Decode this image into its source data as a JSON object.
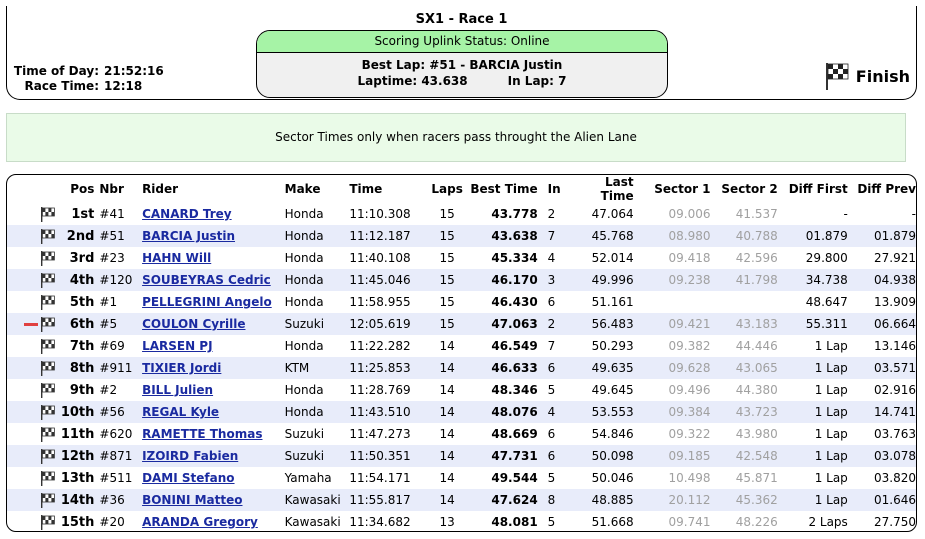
{
  "header": {
    "race_title": "SX1 - Race 1",
    "status_text": "Scoring Uplink Status: Online",
    "best_lap": "Best Lap: #51 - BARCIA Justin",
    "laptime": "Laptime: 43.638",
    "in_lap": "In Lap: 7",
    "time_of_day_label": "Time of Day:",
    "time_of_day": "21:52:16",
    "race_time_label": "Race Time:",
    "race_time": "12:18",
    "finish_label": "Finish"
  },
  "message": "Sector Times only when racers pass throught the Alien Lane",
  "table": {
    "headers": [
      "Pos",
      "Nbr",
      "Rider",
      "Make",
      "Time",
      "Laps",
      "Best Time",
      "In",
      "Last Time",
      "Sector 1",
      "Sector 2",
      "Diff First",
      "Diff Prev"
    ],
    "rows": [
      {
        "pos": "1st",
        "nbr": "#41",
        "rider": "CANARD Trey",
        "make": "Honda",
        "time": "11:10.308",
        "laps": "15",
        "best": "43.778",
        "in": "2",
        "last": "47.064",
        "s1": "09.006",
        "s2": "41.537",
        "diff_first": "-",
        "diff_prev": "-"
      },
      {
        "pos": "2nd",
        "nbr": "#51",
        "rider": "BARCIA Justin",
        "make": "Honda",
        "time": "11:12.187",
        "laps": "15",
        "best": "43.638",
        "in": "7",
        "last": "45.768",
        "s1": "08.980",
        "s2": "40.788",
        "diff_first": "01.879",
        "diff_prev": "01.879"
      },
      {
        "pos": "3rd",
        "nbr": "#23",
        "rider": "HAHN Will",
        "make": "Honda",
        "time": "11:40.108",
        "laps": "15",
        "best": "45.334",
        "in": "4",
        "last": "52.014",
        "s1": "09.418",
        "s2": "42.596",
        "diff_first": "29.800",
        "diff_prev": "27.921"
      },
      {
        "pos": "4th",
        "nbr": "#120",
        "rider": "SOUBEYRAS Cedric",
        "make": "Honda",
        "time": "11:45.046",
        "laps": "15",
        "best": "46.170",
        "in": "3",
        "last": "49.996",
        "s1": "09.238",
        "s2": "41.798",
        "diff_first": "34.738",
        "diff_prev": "04.938"
      },
      {
        "pos": "5th",
        "nbr": "#1",
        "rider": "PELLEGRINI Angelo",
        "make": "Honda",
        "time": "11:58.955",
        "laps": "15",
        "best": "46.430",
        "in": "6",
        "last": "51.161",
        "s1": "",
        "s2": "",
        "diff_first": "48.647",
        "diff_prev": "13.909"
      },
      {
        "pos": "6th",
        "nbr": "#5",
        "rider": "COULON Cyrille",
        "make": "Suzuki",
        "time": "12:05.619",
        "laps": "15",
        "best": "47.063",
        "in": "2",
        "last": "56.483",
        "s1": "09.421",
        "s2": "43.183",
        "diff_first": "55.311",
        "diff_prev": "06.664",
        "marker": true
      },
      {
        "pos": "7th",
        "nbr": "#69",
        "rider": "LARSEN PJ",
        "make": "Honda",
        "time": "11:22.282",
        "laps": "14",
        "best": "46.549",
        "in": "7",
        "last": "50.293",
        "s1": "09.382",
        "s2": "44.446",
        "diff_first": "1 Lap",
        "diff_prev": "13.146"
      },
      {
        "pos": "8th",
        "nbr": "#911",
        "rider": "TIXIER Jordi",
        "make": "KTM",
        "time": "11:25.853",
        "laps": "14",
        "best": "46.633",
        "in": "6",
        "last": "49.635",
        "s1": "09.628",
        "s2": "43.065",
        "diff_first": "1 Lap",
        "diff_prev": "03.571"
      },
      {
        "pos": "9th",
        "nbr": "#2",
        "rider": "BILL Julien",
        "make": "Honda",
        "time": "11:28.769",
        "laps": "14",
        "best": "48.346",
        "in": "5",
        "last": "49.645",
        "s1": "09.496",
        "s2": "44.380",
        "diff_first": "1 Lap",
        "diff_prev": "02.916"
      },
      {
        "pos": "10th",
        "nbr": "#56",
        "rider": "REGAL Kyle",
        "make": "Honda",
        "time": "11:43.510",
        "laps": "14",
        "best": "48.076",
        "in": "4",
        "last": "53.553",
        "s1": "09.384",
        "s2": "43.723",
        "diff_first": "1 Lap",
        "diff_prev": "14.741"
      },
      {
        "pos": "11th",
        "nbr": "#620",
        "rider": "RAMETTE Thomas",
        "make": "Suzuki",
        "time": "11:47.273",
        "laps": "14",
        "best": "48.669",
        "in": "6",
        "last": "54.846",
        "s1": "09.322",
        "s2": "43.980",
        "diff_first": "1 Lap",
        "diff_prev": "03.763"
      },
      {
        "pos": "12th",
        "nbr": "#871",
        "rider": "IZOIRD Fabien",
        "make": "Suzuki",
        "time": "11:50.351",
        "laps": "14",
        "best": "47.731",
        "in": "6",
        "last": "50.098",
        "s1": "09.185",
        "s2": "42.548",
        "diff_first": "1 Lap",
        "diff_prev": "03.078"
      },
      {
        "pos": "13th",
        "nbr": "#511",
        "rider": "DAMI Stefano",
        "make": "Yamaha",
        "time": "11:54.171",
        "laps": "14",
        "best": "49.544",
        "in": "5",
        "last": "50.046",
        "s1": "10.498",
        "s2": "45.871",
        "diff_first": "1 Lap",
        "diff_prev": "03.820"
      },
      {
        "pos": "14th",
        "nbr": "#36",
        "rider": "BONINI Matteo",
        "make": "Kawasaki",
        "time": "11:55.817",
        "laps": "14",
        "best": "47.624",
        "in": "8",
        "last": "48.885",
        "s1": "20.112",
        "s2": "45.362",
        "diff_first": "1 Lap",
        "diff_prev": "01.646"
      },
      {
        "pos": "15th",
        "nbr": "#20",
        "rider": "ARANDA Gregory",
        "make": "Kawasaki",
        "time": "11:34.682",
        "laps": "13",
        "best": "48.081",
        "in": "5",
        "last": "51.668",
        "s1": "09.741",
        "s2": "48.226",
        "diff_first": "2 Laps",
        "diff_prev": "27.750"
      }
    ]
  }
}
